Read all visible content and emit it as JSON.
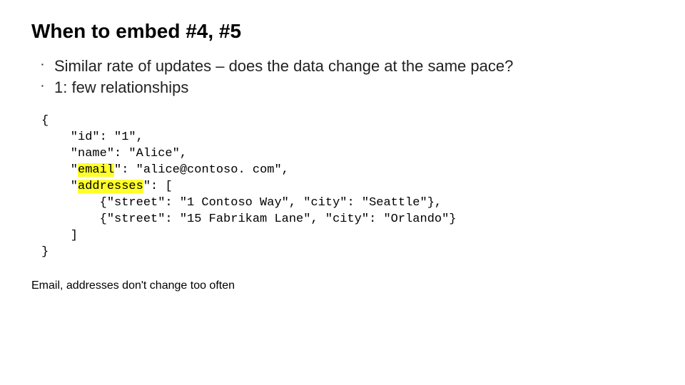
{
  "title": "When to embed #4, #5",
  "bullets": [
    "Similar rate of updates – does the data change at the same pace?",
    "1: few relationships"
  ],
  "code": {
    "l0": "{",
    "l1": "    \"id\": \"1\",",
    "l2": "    \"name\": \"Alice\",",
    "l3a": "    \"",
    "l3hl": "email",
    "l3b": "\": \"alice@contoso. com\",",
    "l4a": "    \"",
    "l4hl": "addresses",
    "l4b": "\": [",
    "l5": "        {\"street\": \"1 Contoso Way\", \"city\": \"Seattle\"},",
    "l6": "        {\"street\": \"15 Fabrikam Lane\", \"city\": \"Orlando\"}",
    "l7": "    ]",
    "l8": "}"
  },
  "footnote": "Email, addresses don't change too often"
}
